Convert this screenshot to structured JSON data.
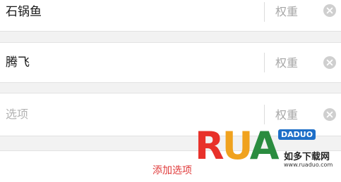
{
  "options": [
    {
      "text": "石锅鱼",
      "weight_placeholder": "权重",
      "is_placeholder": false
    },
    {
      "text": "腾飞",
      "weight_placeholder": "权重",
      "is_placeholder": false
    },
    {
      "text": "选项",
      "weight_placeholder": "权重",
      "is_placeholder": true
    }
  ],
  "add_option_label": "添加选项",
  "icons": {
    "clear": "clear-icon"
  },
  "colors": {
    "add_option": "#e03a3a",
    "placeholder": "#b3b3b3",
    "clear_icon": "#cfcfcf"
  },
  "watermark": {
    "letters": [
      "R",
      "U",
      "A",
      "D",
      "U",
      "O"
    ],
    "tag": "DADUO",
    "cn": "如多下载网",
    "url": "www.ruaduo.com"
  }
}
